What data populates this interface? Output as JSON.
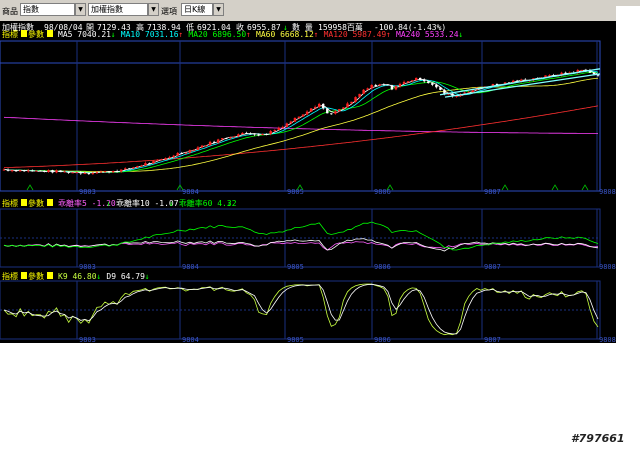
{
  "toolbar": {
    "product_label": "商品",
    "product_value": "指數",
    "index_value": "加權指數",
    "field_label": "選項",
    "period_value": "日K線"
  },
  "header": {
    "name": "加權指數",
    "date": "98/08/04",
    "open_label": "開",
    "open": "7129.43",
    "high_label": "高",
    "high": "7138.94",
    "low_label": "低",
    "low": "6921.04",
    "close_label": "收",
    "close": "6955.87",
    "close_arrow": "↓",
    "volume_label": "數 量",
    "volume": "159958百萬",
    "change": "-100.84(-1.43%)"
  },
  "colors": {
    "background": "#000000",
    "up": "#ff2020",
    "down": "#ffffff",
    "grid": "#1a2f80",
    "price_frame": "#2c4bc0",
    "label_yellow": "#ffff00",
    "label_green": "#00ff00",
    "ma5": "#ffffff",
    "ma10": "#00ffff",
    "ma20": "#00ff00",
    "ma60": "#ffff40",
    "ma120": "#ff3030",
    "ma240": "#ff40ff",
    "rate5": "#ff60ff",
    "rate10": "#ffffff",
    "rate60": "#00ff00",
    "k9": "#c8ff40",
    "d9": "#ffffff",
    "trendline": "#80ffff"
  },
  "chart_data": [
    {
      "type": "candlestick",
      "panel": "price",
      "indicator_label": "指標",
      "param_label": "參數",
      "x_months": [
        "9803",
        "9804",
        "9805",
        "9806",
        "9807",
        "9808"
      ],
      "series": [
        {
          "name": "MA5",
          "value": "7040.21",
          "arrow": "↓"
        },
        {
          "name": "MA10",
          "value": "7031.16",
          "arrow": "↑"
        },
        {
          "name": "MA20",
          "value": "6896.50",
          "arrow": "↑"
        },
        {
          "name": "MA60",
          "value": "6668.12",
          "arrow": "↑"
        },
        {
          "name": "MA120",
          "value": "5987.49",
          "arrow": "↑"
        },
        {
          "name": "MA240",
          "value": "5533.24",
          "arrow": "↓"
        }
      ],
      "ylim": [
        4100,
        7300
      ],
      "close_path": [
        [
          0,
          4550
        ],
        [
          10,
          4520
        ],
        [
          20,
          4510
        ],
        [
          30,
          4490
        ],
        [
          40,
          4470
        ],
        [
          50,
          4490
        ],
        [
          60,
          4550
        ],
        [
          70,
          4700
        ],
        [
          78,
          4800
        ],
        [
          85,
          4950
        ],
        [
          92,
          5050
        ],
        [
          100,
          5200
        ],
        [
          108,
          5350
        ],
        [
          115,
          5450
        ],
        [
          122,
          5500
        ],
        [
          128,
          5450
        ],
        [
          135,
          5600
        ],
        [
          142,
          5800
        ],
        [
          148,
          6000
        ],
        [
          152,
          6150
        ],
        [
          156,
          6250
        ],
        [
          160,
          6000
        ],
        [
          165,
          6050
        ],
        [
          172,
          6300
        ],
        [
          178,
          6600
        ],
        [
          182,
          6700
        ],
        [
          188,
          6750
        ],
        [
          192,
          6650
        ],
        [
          196,
          6750
        ],
        [
          200,
          6850
        ],
        [
          206,
          6900
        ],
        [
          212,
          6750
        ],
        [
          218,
          6500
        ],
        [
          224,
          6450
        ],
        [
          228,
          6550
        ],
        [
          232,
          6600
        ],
        [
          238,
          6700
        ],
        [
          244,
          6750
        ],
        [
          250,
          6800
        ],
        [
          256,
          6850
        ],
        [
          262,
          6900
        ],
        [
          268,
          6950
        ],
        [
          274,
          7000
        ],
        [
          280,
          7050
        ],
        [
          286,
          7120
        ],
        [
          290,
          7080
        ],
        [
          294,
          6955
        ]
      ]
    },
    {
      "type": "line",
      "panel": "deviation_rate",
      "indicator_label": "指標",
      "param_label": "參數",
      "series": [
        {
          "name": "乖離率5",
          "value": "-1.20",
          "arrow": "↓"
        },
        {
          "name": "乖離率10",
          "value": "-1.07",
          "arrow": "↓"
        },
        {
          "name": "乖離率60",
          "value": "4.32",
          "arrow": "↓"
        }
      ],
      "ylim": [
        -15,
        25
      ]
    },
    {
      "type": "line",
      "panel": "kd",
      "indicator_label": "指標",
      "param_label": "參數",
      "series": [
        {
          "name": "K9",
          "value": "46.80",
          "arrow": "↓"
        },
        {
          "name": "D9",
          "value": "64.79",
          "arrow": "↓"
        }
      ],
      "ylim": [
        0,
        100
      ]
    }
  ],
  "watermark": "#797661"
}
